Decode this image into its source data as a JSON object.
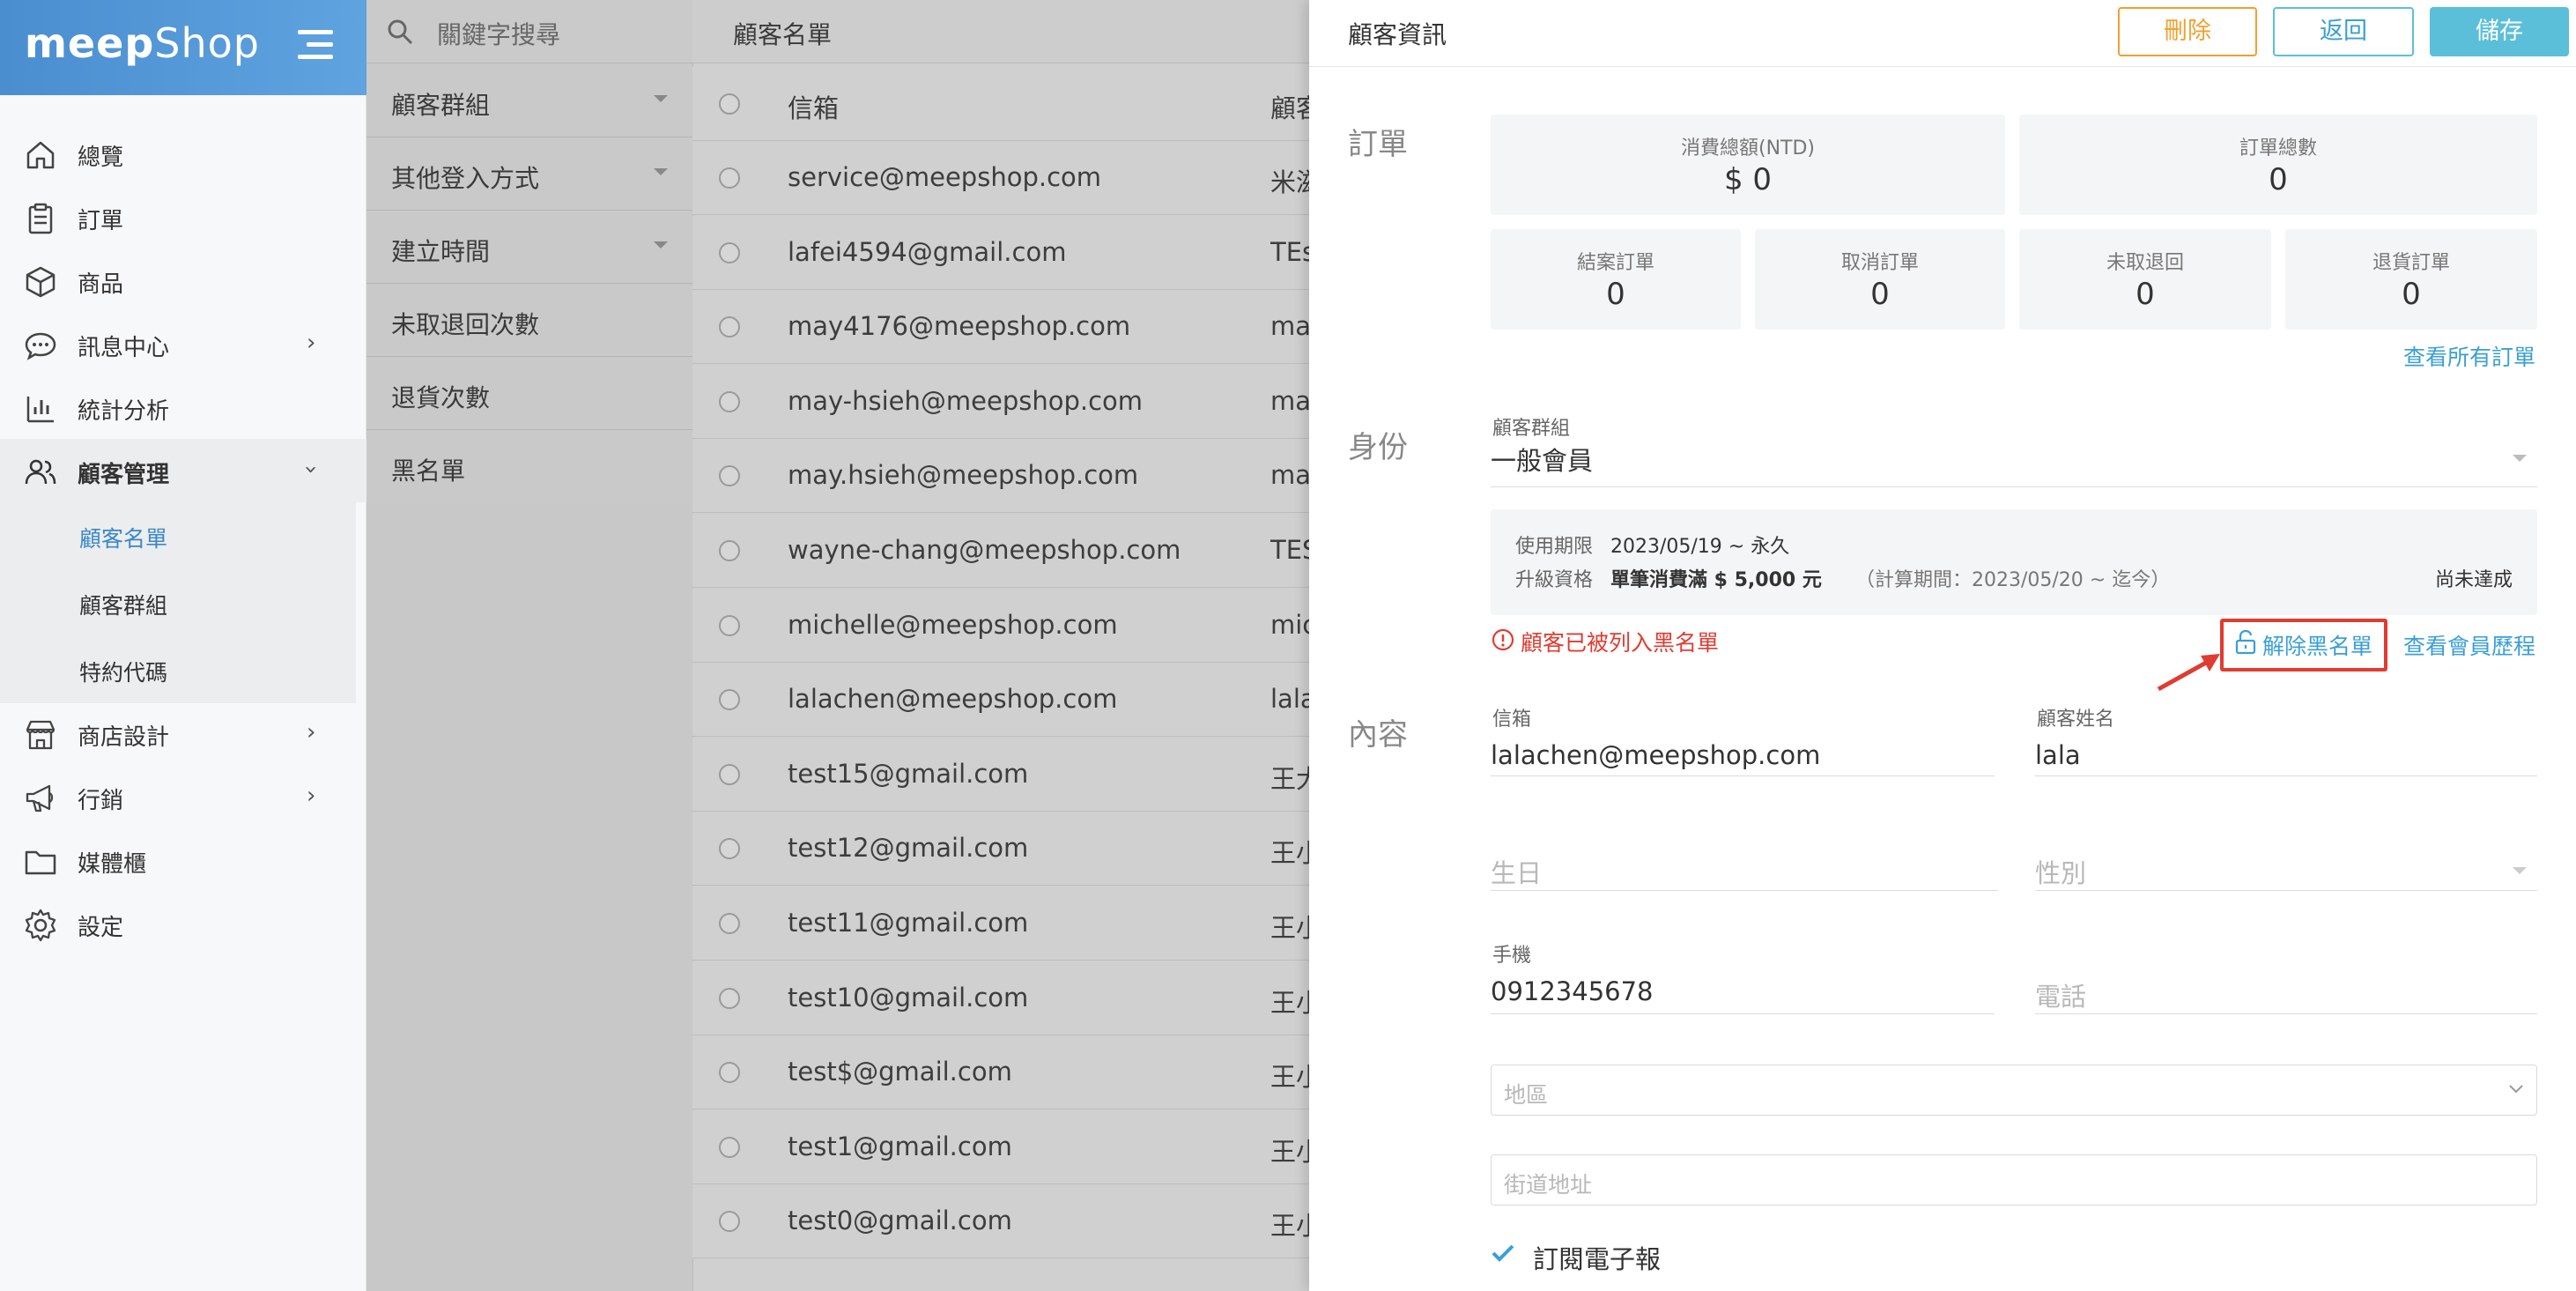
{
  "sidebar": {
    "logo_bold": "meep",
    "logo_light": "Shop",
    "items": [
      {
        "label": "總覽",
        "icon": "home-icon"
      },
      {
        "label": "訂單",
        "icon": "clipboard-icon"
      },
      {
        "label": "商品",
        "icon": "box-icon"
      },
      {
        "label": "訊息中心",
        "icon": "chat-icon"
      },
      {
        "label": "統計分析",
        "icon": "bar-chart-icon"
      },
      {
        "label": "顧客管理",
        "icon": "users-icon"
      },
      {
        "label": "商店設計",
        "icon": "store-icon"
      },
      {
        "label": "行銷",
        "icon": "megaphone-icon"
      },
      {
        "label": "媒體櫃",
        "icon": "folder-icon"
      },
      {
        "label": "設定",
        "icon": "gear-icon"
      }
    ],
    "sub_items": [
      "顧客名單",
      "顧客群組",
      "特約代碼"
    ]
  },
  "filters": {
    "search_placeholder": "關鍵字搜尋",
    "items": [
      "顧客群組",
      "其他登入方式",
      "建立時間",
      "未取退回次數",
      "退貨次數",
      "黑名單"
    ]
  },
  "list": {
    "title": "顧客名單",
    "col_email": "信箱",
    "col_name": "顧客",
    "rows": [
      {
        "email": "service@meepshop.com",
        "name": "米滋"
      },
      {
        "email": "lafei4594@gmail.com",
        "name": "TEst"
      },
      {
        "email": "may4176@meepshop.com",
        "name": "may"
      },
      {
        "email": "may-hsieh@meepshop.com",
        "name": "may"
      },
      {
        "email": "may.hsieh@meepshop.com",
        "name": "may"
      },
      {
        "email": "wayne-chang@meepshop.com",
        "name": "TES"
      },
      {
        "email": "michelle@meepshop.com",
        "name": "mic"
      },
      {
        "email": "lalachen@meepshop.com",
        "name": "lala"
      },
      {
        "email": "test15@gmail.com",
        "name": "王大"
      },
      {
        "email": "test12@gmail.com",
        "name": "王小"
      },
      {
        "email": "test11@gmail.com",
        "name": "王小"
      },
      {
        "email": "test10@gmail.com",
        "name": "王小"
      },
      {
        "email": "test$@gmail.com",
        "name": "王小"
      },
      {
        "email": "test1@gmail.com",
        "name": "王小"
      },
      {
        "email": "test0@gmail.com",
        "name": "王小"
      }
    ]
  },
  "detail": {
    "title": "顧客資訊",
    "delete_label": "刪除",
    "back_label": "返回",
    "save_label": "儲存",
    "orders": {
      "section": "訂單",
      "total_spent_label": "消費總額(NTD)",
      "total_spent": "$ 0",
      "total_orders_label": "訂單總數",
      "total_orders": "0",
      "closed_label": "結案訂單",
      "closed": "0",
      "cancelled_label": "取消訂單",
      "cancelled": "0",
      "unclaimed_label": "未取退回",
      "unclaimed": "0",
      "returns_label": "退貨訂單",
      "returns": "0",
      "view_all": "查看所有訂單"
    },
    "identity": {
      "section": "身份",
      "group_label": "顧客群組",
      "group_value": "一般會員",
      "validity_label": "使用期限",
      "validity_value": "2023/05/19 ~ 永久",
      "upgrade_label": "升級資格",
      "upgrade_rule": "單筆消費滿 $ 5,000 元",
      "upgrade_period": "（計算期間：2023/05/20 ~ 迄今）",
      "upgrade_status": "尚未達成",
      "blacklisted_msg": "顧客已被列入黑名單",
      "unblacklist": "解除黑名單",
      "view_history": "查看會員歷程"
    },
    "content": {
      "section": "內容",
      "email_label": "信箱",
      "email_value": "lalachen@meepshop.com",
      "name_label": "顧客姓名",
      "name_value": "lala",
      "birthday_ph": "生日",
      "gender_ph": "性別",
      "mobile_label": "手機",
      "mobile_value": "0912345678",
      "phone_ph": "電話",
      "region_ph": "地區",
      "street_ph": "街道地址",
      "newsletter_label": "訂閱電子報"
    }
  },
  "colors": {
    "brand_blue": "#4a8ed0",
    "link_blue": "#3a9fd6",
    "danger_orange": "#f0a030",
    "alert_red": "#e03c31",
    "save_blue": "#5bbfd9"
  }
}
